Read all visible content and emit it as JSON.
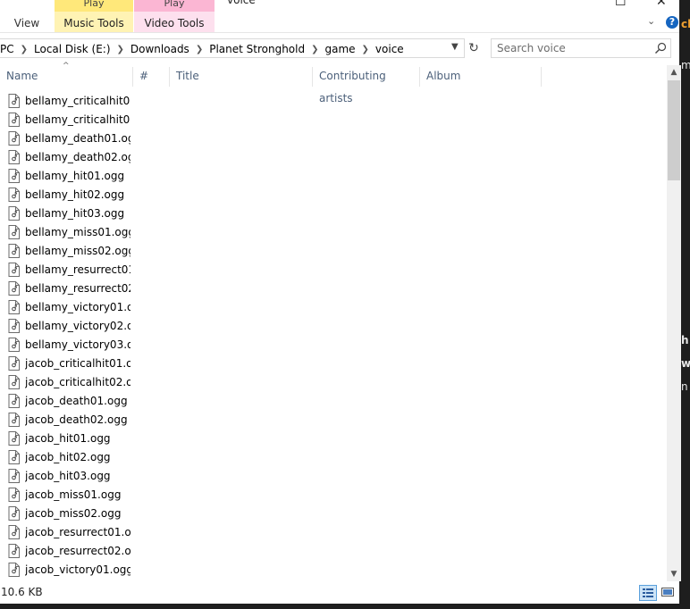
{
  "window": {
    "title": "voice"
  },
  "ribbon": {
    "tabs": [
      {
        "label": "View"
      }
    ],
    "contextual": [
      {
        "group": "Play",
        "label": "Music Tools",
        "color": "#ffe87a"
      },
      {
        "group": "Play",
        "label": "Video Tools",
        "color": "#fbb6d3"
      }
    ]
  },
  "address": {
    "crumbs": [
      "PC",
      "Local Disk (E:)",
      "Downloads",
      "Planet Stronghold",
      "game",
      "voice"
    ]
  },
  "search": {
    "placeholder": "Search voice",
    "icon": "search-icon"
  },
  "columns": [
    {
      "label": "Name"
    },
    {
      "label": "#"
    },
    {
      "label": "Title"
    },
    {
      "label": "Contributing artists"
    },
    {
      "label": "Album"
    }
  ],
  "files": [
    "bellamy_criticalhit0...",
    "bellamy_criticalhit0...",
    "bellamy_death01.ogg",
    "bellamy_death02.ogg",
    "bellamy_hit01.ogg",
    "bellamy_hit02.ogg",
    "bellamy_hit03.ogg",
    "bellamy_miss01.ogg",
    "bellamy_miss02.ogg",
    "bellamy_resurrect01...",
    "bellamy_resurrect02...",
    "bellamy_victory01.o...",
    "bellamy_victory02.o...",
    "bellamy_victory03.o...",
    "jacob_criticalhit01.o...",
    "jacob_criticalhit02.o...",
    "jacob_death01.ogg",
    "jacob_death02.ogg",
    "jacob_hit01.ogg",
    "jacob_hit02.ogg",
    "jacob_hit03.ogg",
    "jacob_miss01.ogg",
    "jacob_miss02.ogg",
    "jacob_resurrect01.o...",
    "jacob_resurrect02.o...",
    "jacob_victory01.ogg"
  ],
  "status": {
    "text": "10.6 KB"
  },
  "background_fragments": [
    "ch",
    "h",
    "w",
    "n",
    "m"
  ],
  "colors": {
    "accent": "#1565c0",
    "header_text": "#4c607a"
  }
}
